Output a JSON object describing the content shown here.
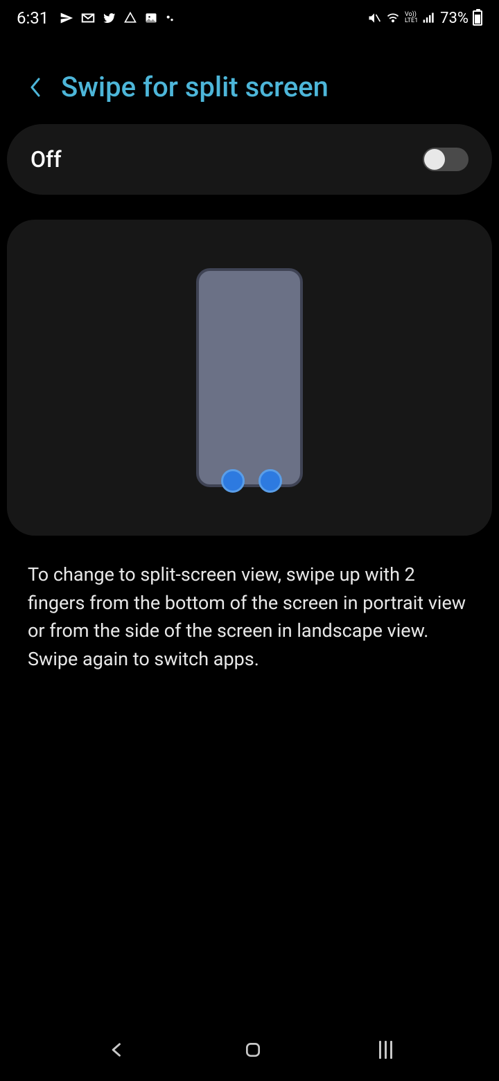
{
  "status_bar": {
    "time": "6:31",
    "battery_percent": "73%"
  },
  "header": {
    "title": "Swipe for split screen"
  },
  "toggle": {
    "label": "Off",
    "on": false
  },
  "description": "To change to split-screen view, swipe up with 2 fingers from the bottom of the screen in portrait view or from the side of the screen in landscape view. Swipe again to switch apps."
}
